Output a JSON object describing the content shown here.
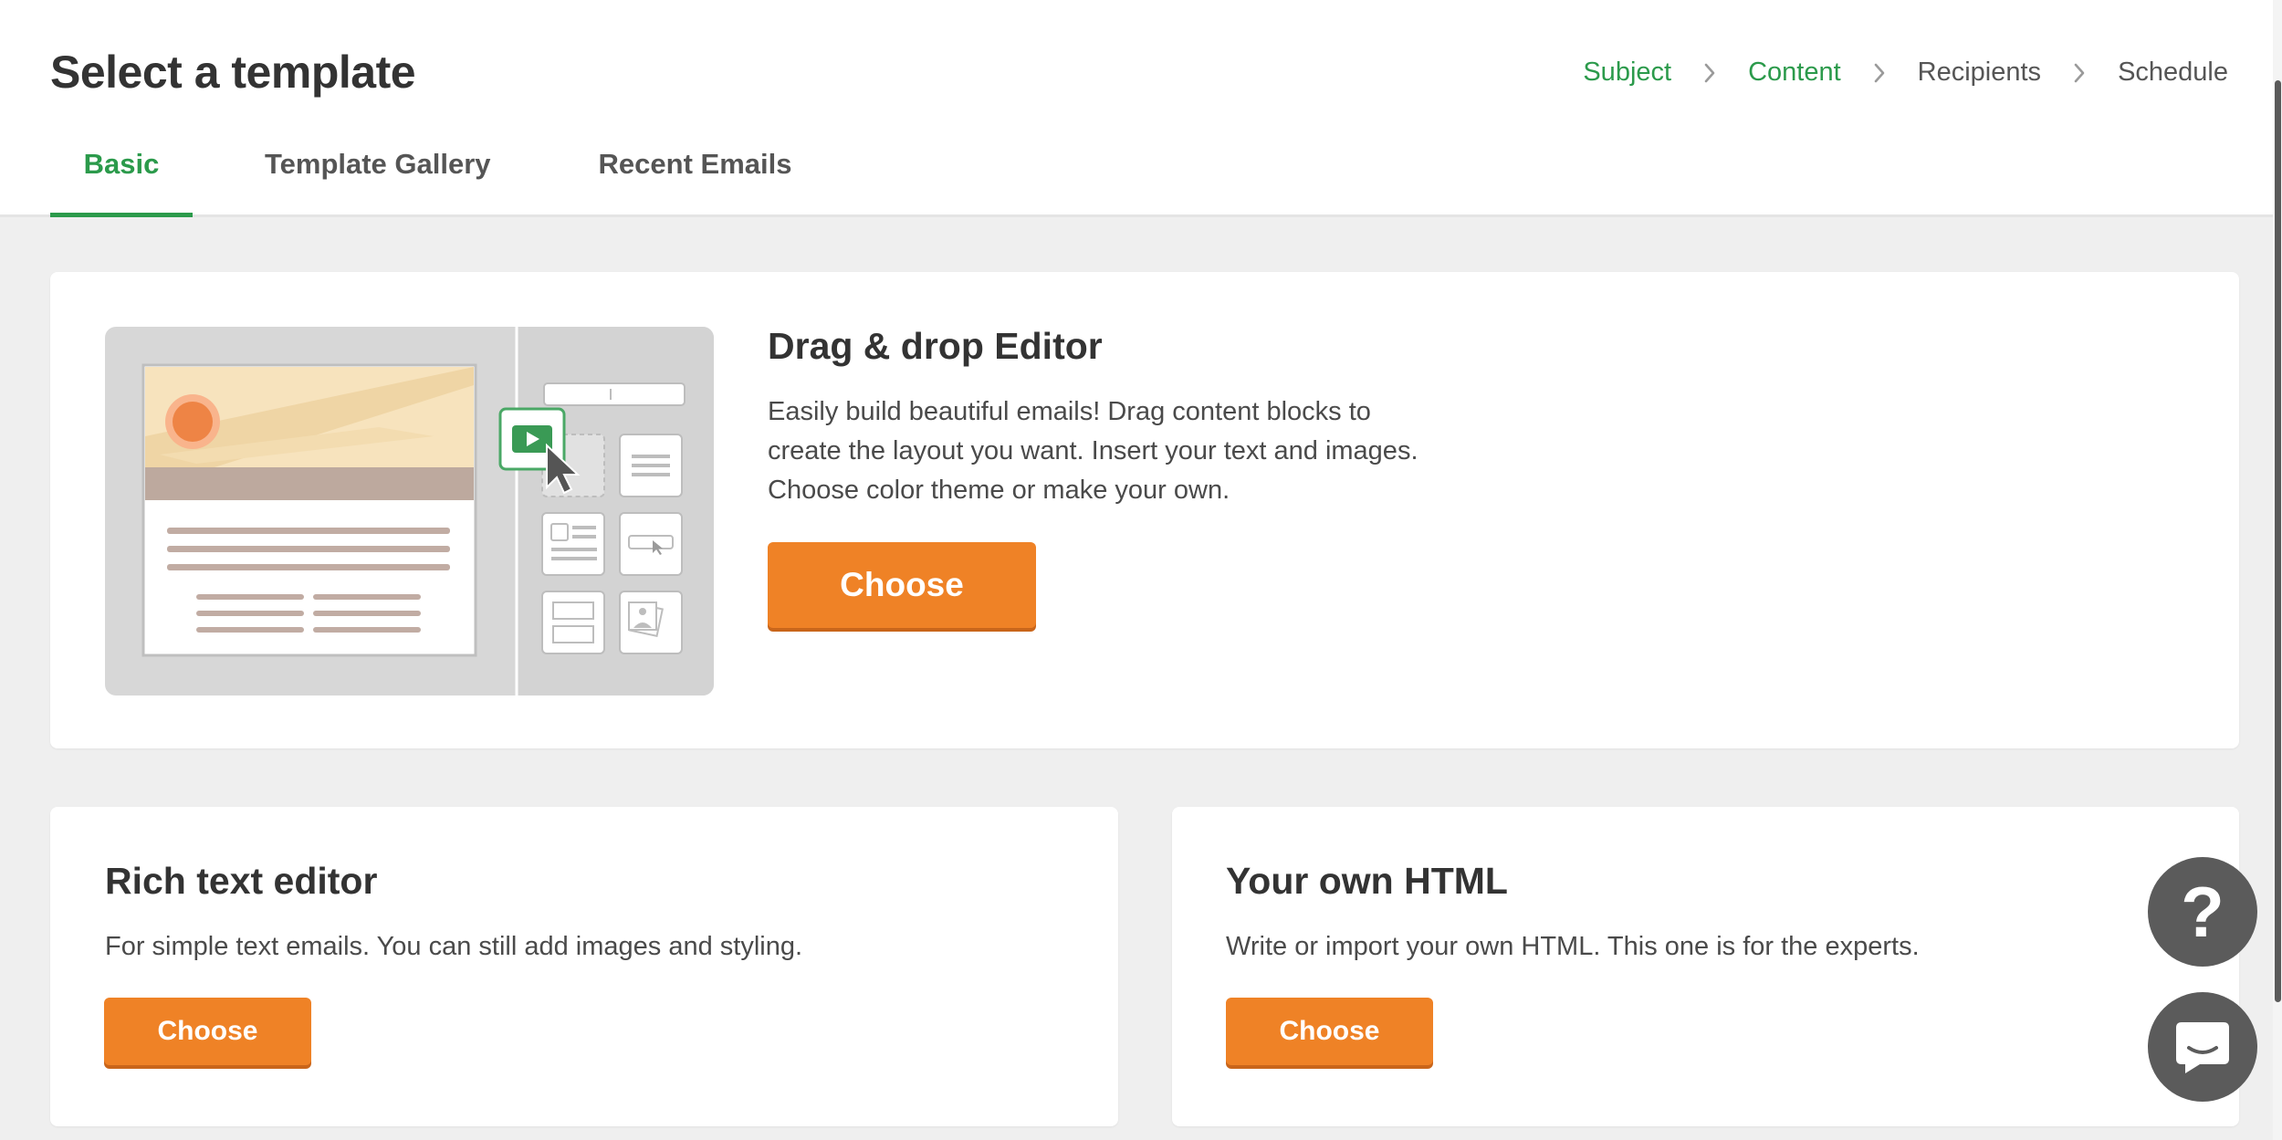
{
  "page": {
    "title": "Select a template"
  },
  "breadcrumb": {
    "steps": [
      {
        "label": "Subject"
      },
      {
        "label": "Content"
      },
      {
        "label": "Recipients"
      },
      {
        "label": "Schedule"
      }
    ]
  },
  "tabs": [
    {
      "label": "Basic"
    },
    {
      "label": "Template Gallery"
    },
    {
      "label": "Recent Emails"
    }
  ],
  "editors": {
    "drag_drop": {
      "title": "Drag & drop Editor",
      "description_lines": [
        "Easily build beautiful emails! Drag content blocks to",
        "create the layout you want. Insert your text and images.",
        "Choose color theme or make your own."
      ],
      "button": "Choose"
    },
    "rich_text": {
      "title": "Rich text editor",
      "description": "For simple text emails. You can still add images and styling.",
      "button": "Choose"
    },
    "own_html": {
      "title": "Your own HTML",
      "description": "Write or import your own HTML. This one is for the experts.",
      "button": "Choose"
    }
  },
  "help": {
    "glyph": "?"
  },
  "colors": {
    "accent_green": "#2b9a4b",
    "button_orange": "#ef8226",
    "background_grey": "#efefef",
    "floating_button": "#5b5b5b"
  },
  "icons": {
    "breadcrumb_separator": "chevron-right-icon",
    "help": "question-mark-icon",
    "chat": "chat-bubble-icon"
  }
}
